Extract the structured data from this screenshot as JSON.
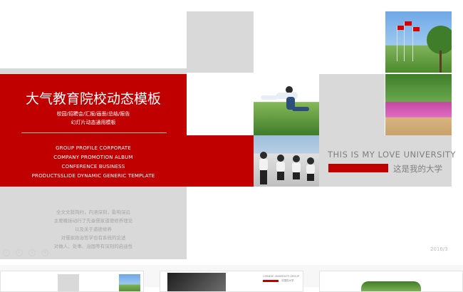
{
  "slide": {
    "title_cn": "大气教育院校动态模板",
    "subtitle_line1": "校园/招聘会/汇报/画册/总结/报告",
    "subtitle_line2": "幻灯片动态通用模板",
    "en_lines": [
      "GROUP PROFILE CORPORATE",
      "COMPANY PROMOTION   ALBUM",
      "CONFERENCE  BUSINESS",
      "PRODUCTSSLIDE DYNAMIC GENERIC TEMPLATE"
    ],
    "paragraph_lines": [
      "全文文辞简约，内涵深刻，影响深远",
      "主要概括动行了先秦儒家道德修养理论",
      "以及关于道德修养",
      "对儒家政治哲学也有系统的论述",
      "对做人、处事、治国等有深刻的启迪性"
    ],
    "love_en": "THIS IS MY LOVE UNIVERSITY",
    "love_cn": "这是我的大学",
    "date": "2016/3"
  },
  "controls": {
    "icons": [
      "previous-icon",
      "next-icon",
      "menu-icon",
      "zoom-icon"
    ],
    "glyphs": [
      "‹",
      "›",
      "≡",
      "⊕"
    ]
  },
  "thumbnails": {
    "thumb2_line1": "CHINESE UNIVERSITY GROUP",
    "thumb2_line2": "中国的大学"
  },
  "colors": {
    "accent_red": "#c00000",
    "block_gray": "#d9d9d9",
    "text_gray": "#7f7f7f"
  }
}
